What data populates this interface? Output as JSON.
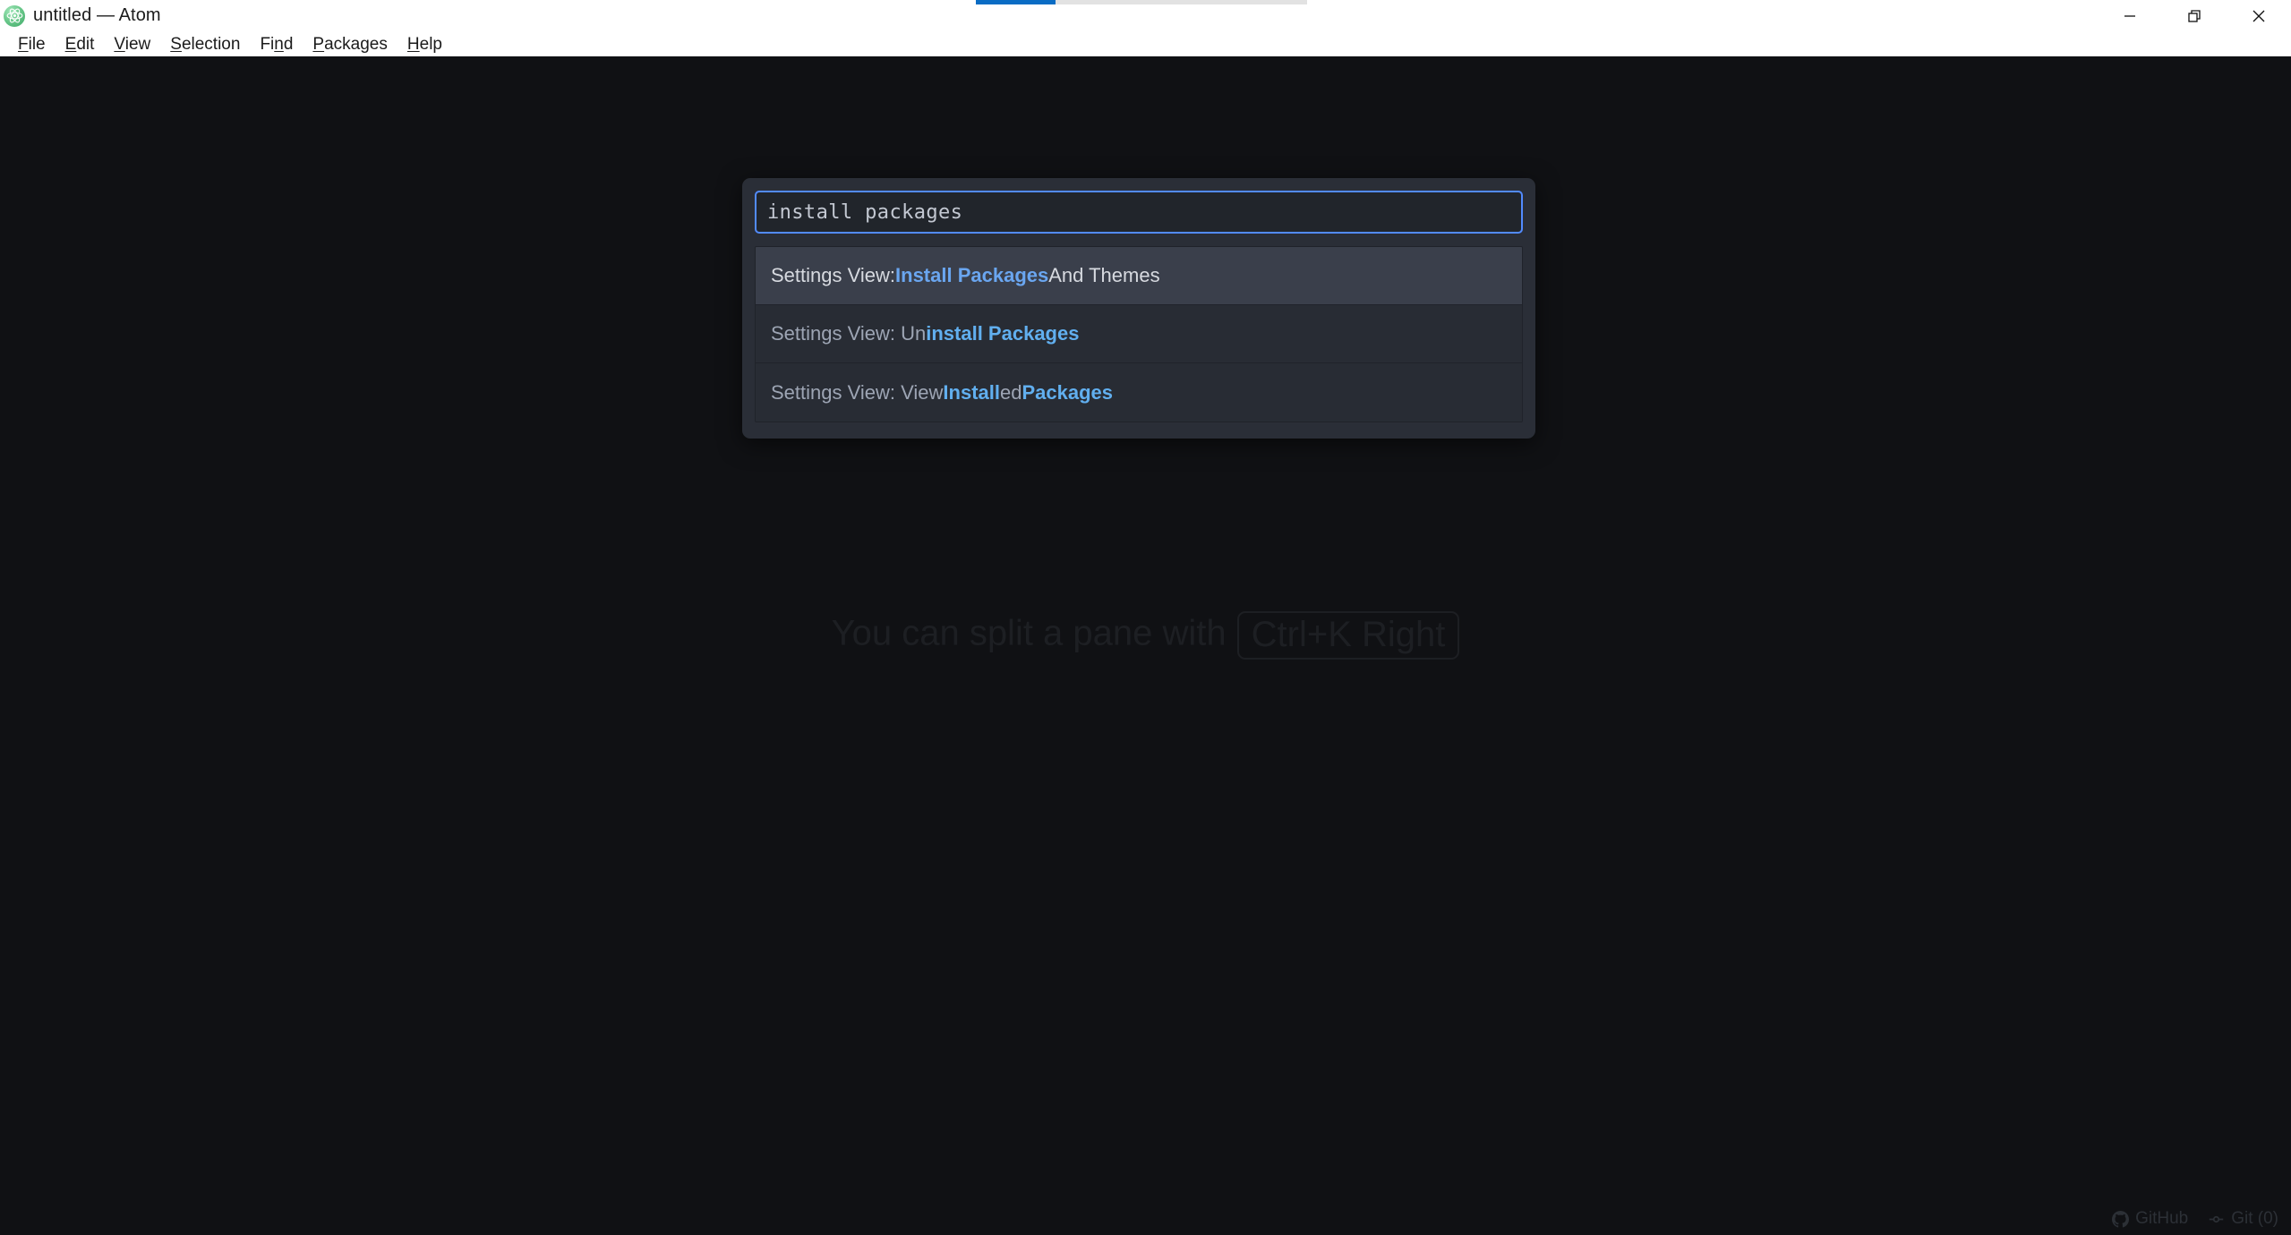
{
  "window": {
    "title": "untitled — Atom",
    "app_icon": "atom-logo-icon",
    "controls": {
      "minimize": "minimize-icon",
      "restore": "restore-icon",
      "close": "close-icon"
    },
    "progress": {
      "value": 24,
      "track_color": "#e2e2e2",
      "fill_color": "#0a6cc4"
    }
  },
  "menubar": {
    "items": [
      {
        "label": "File",
        "pre": "",
        "accel": "F",
        "post": "ile"
      },
      {
        "label": "Edit",
        "pre": "",
        "accel": "E",
        "post": "dit"
      },
      {
        "label": "View",
        "pre": "",
        "accel": "V",
        "post": "iew"
      },
      {
        "label": "Selection",
        "pre": "",
        "accel": "S",
        "post": "election"
      },
      {
        "label": "Find",
        "pre": "Fi",
        "accel": "n",
        "post": "d"
      },
      {
        "label": "Packages",
        "pre": "",
        "accel": "P",
        "post": "ackages"
      },
      {
        "label": "Help",
        "pre": "",
        "accel": "H",
        "post": "elp"
      }
    ]
  },
  "editor": {
    "watermark_text": "You can split a pane with",
    "watermark_key": "Ctrl+K Right",
    "background": "#101114"
  },
  "palette": {
    "input": {
      "value": "install packages",
      "placeholder": "",
      "focus_color": "#528bff"
    },
    "items": [
      {
        "selected": true,
        "parts": [
          {
            "text": "Settings View: ",
            "match": false
          },
          {
            "text": "Install Packages",
            "match": true
          },
          {
            "text": " And Themes",
            "match": false
          }
        ]
      },
      {
        "selected": false,
        "parts": [
          {
            "text": "Settings View: Un",
            "match": false
          },
          {
            "text": "install Packages",
            "match": true
          }
        ]
      },
      {
        "selected": false,
        "parts": [
          {
            "text": "Settings View: View ",
            "match": false
          },
          {
            "text": "Install",
            "match": true
          },
          {
            "text": "ed ",
            "match": false
          },
          {
            "text": "Packages",
            "match": true
          }
        ]
      }
    ],
    "match_color": "#61afef",
    "selected_bg": "#3a3f4b",
    "item_bg": "#282c34"
  },
  "statusbar": {
    "items": [
      {
        "icon": "github-icon",
        "label": "GitHub"
      },
      {
        "icon": "git-branch-icon",
        "label": "Git (0)"
      }
    ]
  }
}
